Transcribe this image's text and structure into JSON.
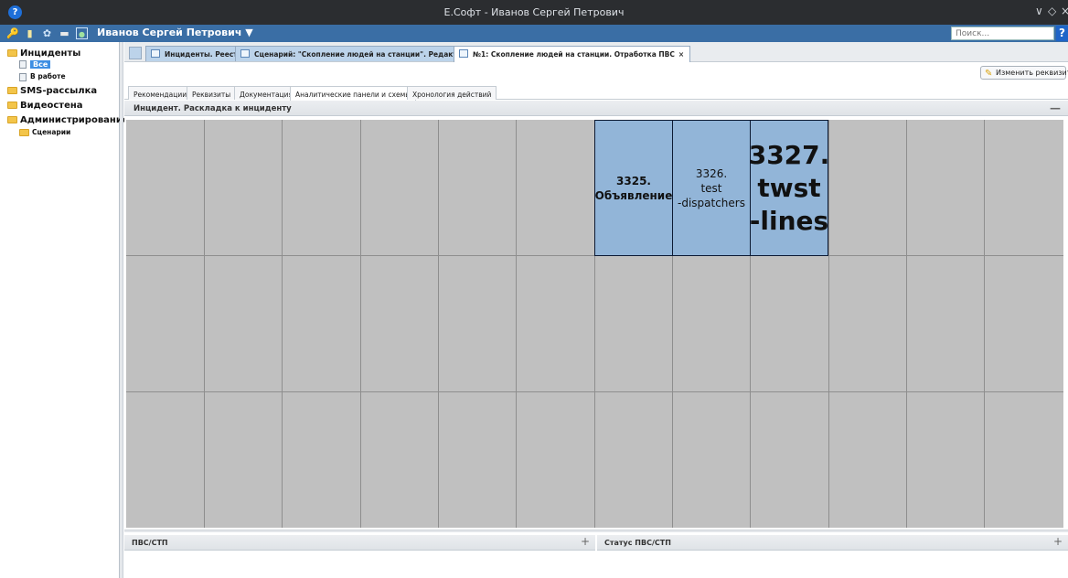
{
  "window": {
    "title": "Е.Софт - Иванов Сергей Петрович",
    "controls": [
      "∨",
      "◇",
      "×"
    ]
  },
  "toolbar": {
    "user": "Иванов Сергей Петрович ▼",
    "search_placeholder": "Поиск...",
    "help": "?"
  },
  "sidebar": {
    "items": [
      {
        "label": "Инциденты"
      },
      {
        "label": "Все"
      },
      {
        "label": "В работе"
      },
      {
        "label": "SMS-рассылка"
      },
      {
        "label": "Видеостена"
      },
      {
        "label": "Администрирование"
      },
      {
        "label": "Сценарии"
      }
    ]
  },
  "doc_tabs": [
    {
      "label": "Инциденты. Реестр",
      "close": "×"
    },
    {
      "label": "Сценарий: \"Скопление людей на станции\". Редактирование",
      "close": "×"
    },
    {
      "label": "№1: Скопление людей на станции. Отработка ПВС",
      "close": "×"
    }
  ],
  "edit_button": {
    "label": "Изменить реквизиты"
  },
  "sub_tabs": [
    "Рекомендации",
    "Реквизиты",
    "Документация",
    "Аналитические панели и схемы",
    "Хронология действий"
  ],
  "panel": {
    "title": "Инцидент. Раскладка к инциденту",
    "collapse": "—"
  },
  "tiles": [
    {
      "line1": "3325.",
      "line2": "Объявление"
    },
    {
      "line1": "3326.",
      "line2": "test",
      "line3": "-dispatchers"
    },
    {
      "line1": "3327.",
      "line2": "twst",
      "line3": "-lines"
    }
  ],
  "bottom": {
    "left": {
      "title": "ПВС/СТП",
      "add": "+"
    },
    "right": {
      "title": "Статус ПВС/СТП",
      "add": "+"
    }
  },
  "colors": {
    "tile": "#92b5d8",
    "grid": "#c0c0c0",
    "toolbar": "#3a6ea5"
  }
}
